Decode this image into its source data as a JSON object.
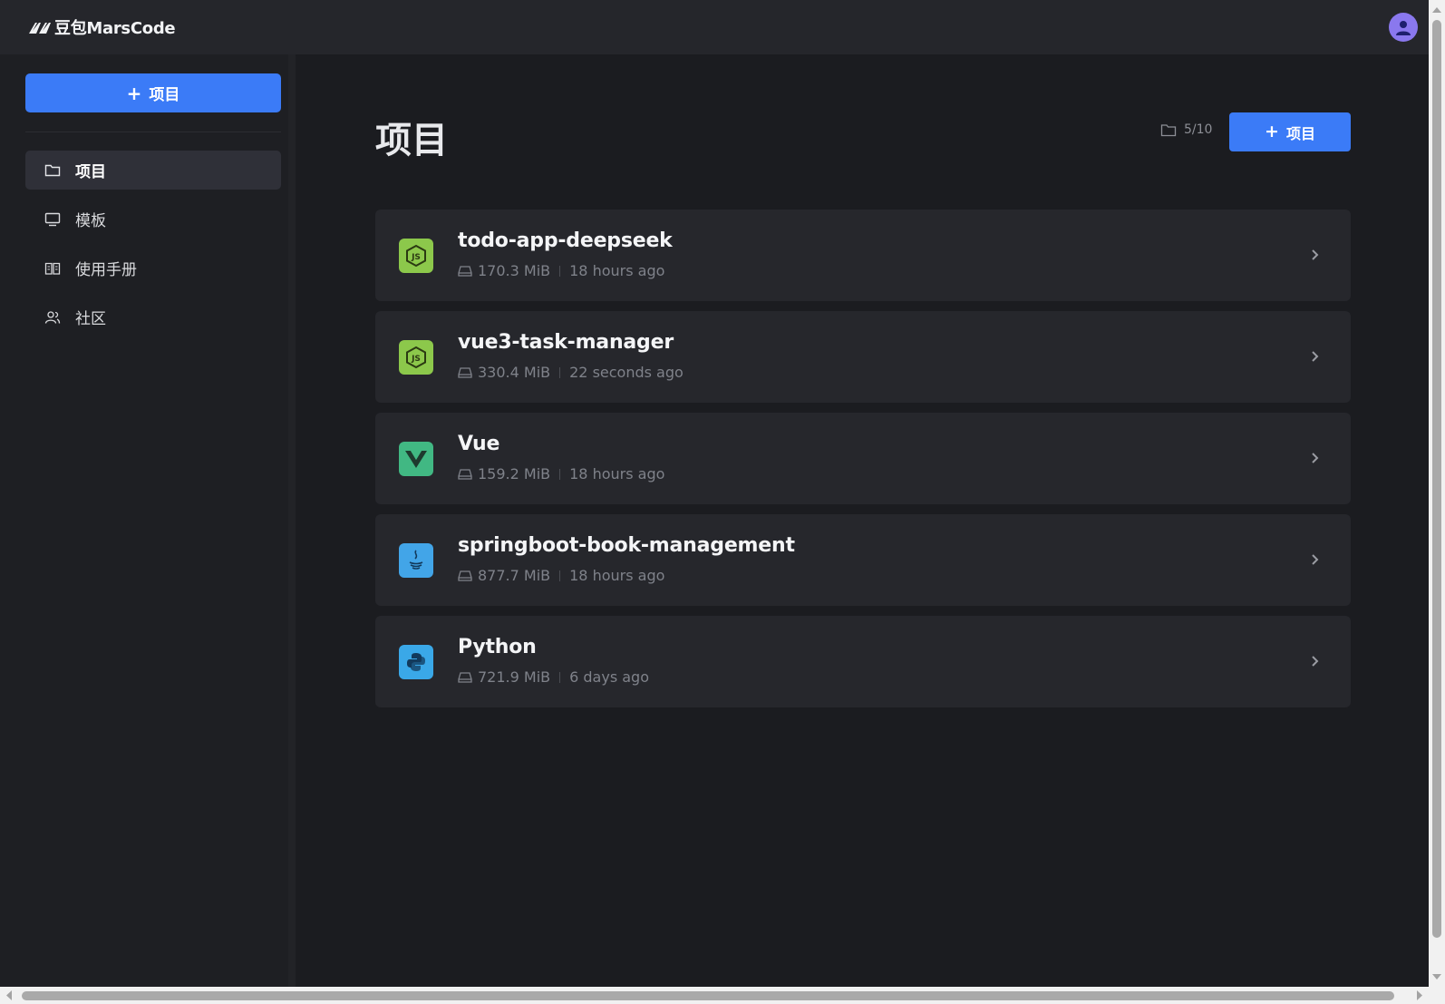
{
  "header": {
    "brand": "豆包MarsCode",
    "avatar_icon": "user-icon"
  },
  "sidebar": {
    "new_button": "项目",
    "items": [
      {
        "label": "项目",
        "icon": "folder-icon",
        "active": true
      },
      {
        "label": "模板",
        "icon": "monitor-icon",
        "active": false
      },
      {
        "label": "使用手册",
        "icon": "book-icon",
        "active": false
      },
      {
        "label": "社区",
        "icon": "users-icon",
        "active": false
      }
    ]
  },
  "main": {
    "title": "项目",
    "quota": "5/10",
    "new_button": "项目",
    "projects": [
      {
        "name": "todo-app-deepseek",
        "size": "170.3 MiB",
        "updated": "18 hours ago",
        "icon": "nodejs-icon"
      },
      {
        "name": "vue3-task-manager",
        "size": "330.4 MiB",
        "updated": "22 seconds ago",
        "icon": "nodejs-icon"
      },
      {
        "name": "Vue",
        "size": "159.2 MiB",
        "updated": "18 hours ago",
        "icon": "vue-icon"
      },
      {
        "name": "springboot-book-management",
        "size": "877.7 MiB",
        "updated": "18 hours ago",
        "icon": "java-icon"
      },
      {
        "name": "Python",
        "size": "721.9 MiB",
        "updated": "6 days ago",
        "icon": "python-icon"
      }
    ]
  },
  "colors": {
    "accent": "#3b7bf7",
    "background": "#1b1c20",
    "card": "#26272c",
    "nodejs": "#8cc84b",
    "vue": "#41b883",
    "java": "#42a5e8",
    "python": "#3aa8e8"
  }
}
